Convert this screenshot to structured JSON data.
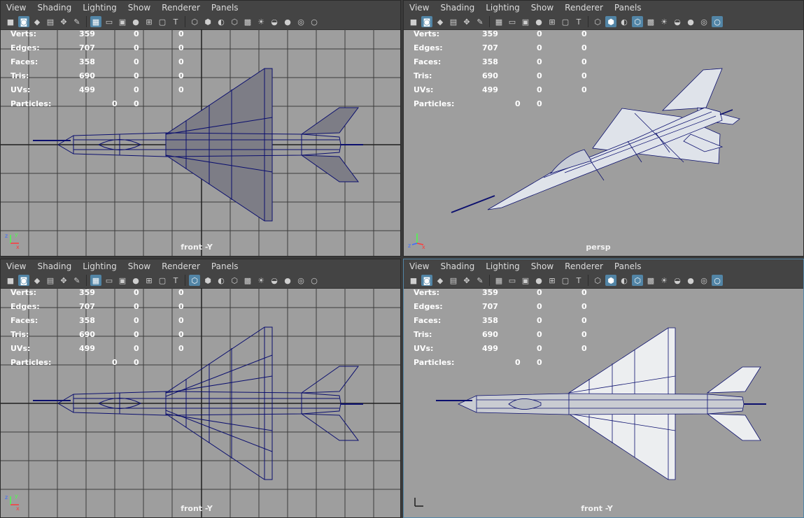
{
  "menus": [
    "View",
    "Shading",
    "Lighting",
    "Show",
    "Renderer",
    "Panels"
  ],
  "hud": {
    "rows": [
      {
        "label": "Verts:",
        "a": "359",
        "b": "0",
        "c": "0"
      },
      {
        "label": "Edges:",
        "a": "707",
        "b": "0",
        "c": "0"
      },
      {
        "label": "Faces:",
        "a": "358",
        "b": "0",
        "c": "0"
      },
      {
        "label": "Tris:",
        "a": "690",
        "b": "0",
        "c": "0"
      },
      {
        "label": "UVs:",
        "a": "499",
        "b": "0",
        "c": "0"
      }
    ],
    "particles": {
      "label": "Particles:",
      "a": "0",
      "b": "0"
    }
  },
  "viewports": [
    {
      "camera": "front -Y"
    },
    {
      "camera": "persp"
    },
    {
      "camera": "front -Y"
    },
    {
      "camera": "front -Y"
    }
  ],
  "axis_labels": {
    "x": "x",
    "y": "y",
    "z": "z"
  },
  "colors": {
    "viewport_bg": "#9e9e9e",
    "wire": "#0b0f6e",
    "active_border": "#5285a6",
    "toolbar_bg": "#444444"
  }
}
